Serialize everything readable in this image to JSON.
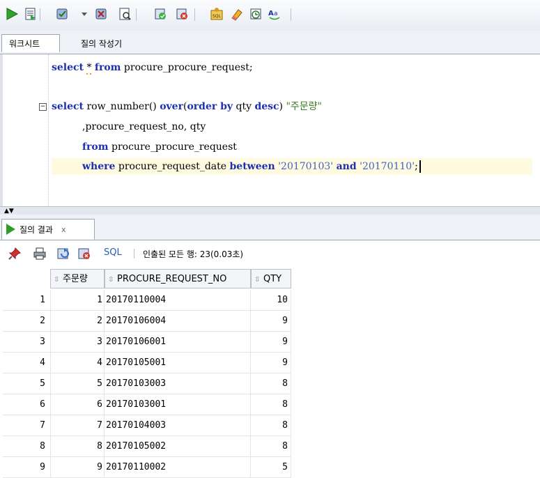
{
  "toolbar": {
    "buttons": [
      {
        "name": "run-statement-icon"
      },
      {
        "name": "run-script-icon"
      },
      {
        "name": "commit-icon"
      },
      {
        "name": "rollback-icon"
      },
      {
        "name": "autotrace-icon"
      },
      {
        "name": "explain-plan-icon"
      },
      {
        "name": "sql-tuning-icon"
      },
      {
        "name": "clear-icon"
      },
      {
        "name": "history-icon"
      },
      {
        "name": "format-icon"
      }
    ]
  },
  "editor_tabs": {
    "worksheet": "워크시트",
    "query_builder": "질의 작성기"
  },
  "code": {
    "line1": {
      "kw_select": "select",
      "star": "*",
      "kw_from": "from",
      "rest": " procure_procure_request;"
    },
    "line3": {
      "kw_select": "select",
      "mid": " row_number() ",
      "kw_over": "over",
      "paren": "(",
      "kw_orderby": "order by",
      "qty": " qty ",
      "kw_desc": "desc",
      "close": ") ",
      "alias": "\"주문량\""
    },
    "line4": {
      "text": ",procure_request_no, qty"
    },
    "line5": {
      "kw_from": "from",
      "rest": " procure_procure_request"
    },
    "line6": {
      "kw_where": "where",
      "col": " procure_request_date ",
      "kw_between": "between",
      "sp1": " ",
      "d1": "'20170103'",
      "sp2": " ",
      "kw_and": "and",
      "sp3": " ",
      "d2": "'20170110'",
      "end": ";"
    }
  },
  "result": {
    "tab_label": "질의 결과",
    "close": "x",
    "sql_link": "SQL",
    "fetched": "인출된 모든 행: 23(0.03초)",
    "columns": [
      "주문량",
      "PROCURE_REQUEST_NO",
      "QTY"
    ],
    "rows": [
      {
        "idx": "1",
        "num": "1",
        "no": "20170110004",
        "qty": "10"
      },
      {
        "idx": "2",
        "num": "2",
        "no": "20170106004",
        "qty": "9"
      },
      {
        "idx": "3",
        "num": "3",
        "no": "20170106001",
        "qty": "9"
      },
      {
        "idx": "4",
        "num": "4",
        "no": "20170105001",
        "qty": "9"
      },
      {
        "idx": "5",
        "num": "5",
        "no": "20170103003",
        "qty": "8"
      },
      {
        "idx": "6",
        "num": "6",
        "no": "20170103001",
        "qty": "8"
      },
      {
        "idx": "7",
        "num": "7",
        "no": "20170104003",
        "qty": "8"
      },
      {
        "idx": "8",
        "num": "8",
        "no": "20170105002",
        "qty": "8"
      },
      {
        "idx": "9",
        "num": "9",
        "no": "20170110002",
        "qty": "5"
      }
    ]
  },
  "colors": {
    "keyword": "#1c2fb0",
    "string": "#3e64c9",
    "alias": "#3d7b1f",
    "current_line": "#fffbe1"
  }
}
